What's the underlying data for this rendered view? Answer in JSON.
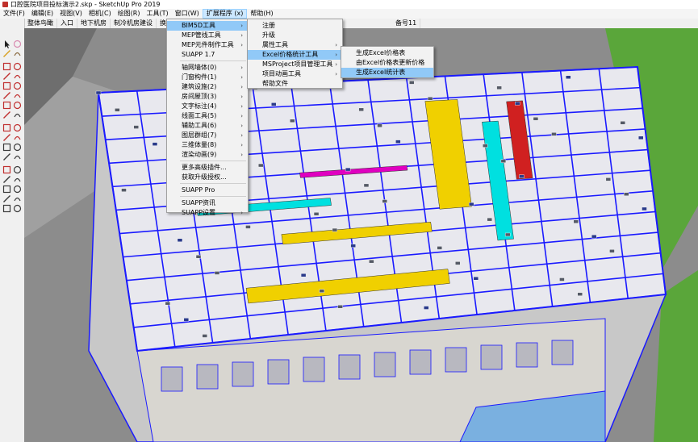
{
  "window": {
    "title": "口腔医院项目投标演示2.skp - SketchUp Pro 2019"
  },
  "menubar": [
    {
      "label": "文件(F)"
    },
    {
      "label": "编辑(E)"
    },
    {
      "label": "视图(V)"
    },
    {
      "label": "相机(C)"
    },
    {
      "label": "绘图(R)"
    },
    {
      "label": "工具(T)"
    },
    {
      "label": "窗口(W)"
    },
    {
      "label": "扩展程序 (x)"
    },
    {
      "label": "帮助(H)"
    }
  ],
  "scene_tabs": [
    "整体鸟瞰",
    "入口",
    "地下机房",
    "制冷机房建设",
    "换热站设备",
    "备号11"
  ],
  "extensions_menu": [
    {
      "label": "BIM5D工具",
      "submenu": true
    },
    {
      "label": "MEP管线工具",
      "submenu": true
    },
    {
      "label": "MEP元件制作工具",
      "submenu": true
    },
    {
      "label": "SUAPP 1.7",
      "submenu": false
    },
    {
      "label": "轴网墙体(0)",
      "submenu": true
    },
    {
      "label": "门窗构件(1)",
      "submenu": true
    },
    {
      "label": "建筑设施(2)",
      "submenu": true
    },
    {
      "label": "房间屋顶(3)",
      "submenu": true
    },
    {
      "label": "文字标注(4)",
      "submenu": true
    },
    {
      "label": "线面工具(5)",
      "submenu": true
    },
    {
      "label": "辅助工具(6)",
      "submenu": true
    },
    {
      "label": "图层群组(7)",
      "submenu": true
    },
    {
      "label": "三维体量(8)",
      "submenu": true
    },
    {
      "label": "渲染动画(9)",
      "submenu": true
    },
    {
      "label": "更多高级插件...",
      "submenu": false
    },
    {
      "label": "获取升级授权...",
      "submenu": false
    },
    {
      "label": "SUAPP Pro",
      "submenu": false
    },
    {
      "label": "SUAPP资讯",
      "submenu": false
    },
    {
      "label": "SUAPP设置",
      "submenu": true
    }
  ],
  "bim5d_menu": [
    {
      "label": "注册",
      "submenu": false
    },
    {
      "label": "升级",
      "submenu": false
    },
    {
      "label": "属性工具",
      "submenu": true
    },
    {
      "label": "Excel价格统计工具",
      "submenu": true
    },
    {
      "label": "MSProject项目管理工具",
      "submenu": true
    },
    {
      "label": "项目动画工具",
      "submenu": true
    },
    {
      "label": "帮助文件",
      "submenu": false
    }
  ],
  "excel_menu": [
    {
      "label": "生成Excel价格表"
    },
    {
      "label": "由Excel价格表更新价格"
    },
    {
      "label": "生成Excel统计表"
    }
  ],
  "toolbar_tools": [
    "select-tool-icon",
    "eraser-tool-icon",
    "paint-bucket-icon",
    "component-icon",
    "line-tool-icon",
    "freehand-tool-icon",
    "rectangle-tool-icon",
    "rotated-rect-icon",
    "circle-tool-icon",
    "polygon-tool-icon",
    "arc-tool-icon",
    "pie-tool-icon",
    "push-pull-icon",
    "follow-me-icon",
    "offset-tool-icon",
    "text-tool-icon",
    "move-tool-icon",
    "rotate-tool-icon",
    "scale-tool-icon",
    "flip-tool-icon",
    "tape-measure-icon",
    "protractor-icon",
    "dimension-tool-icon",
    "axes-tool-icon",
    "orbit-tool-icon",
    "pan-tool-icon",
    "zoom-tool-icon",
    "zoom-window-icon",
    "zoom-extents-icon",
    "previous-view-icon",
    "walk-tool-icon",
    "look-around-icon",
    "position-camera-icon",
    "section-plane-icon"
  ],
  "colors": {
    "menu_highlight": "#91c9f7",
    "model_edges": "#1a1aff",
    "duct_yellow": "#f0d000",
    "pipe_cyan": "#00e0e0",
    "pipe_magenta": "#e000c0"
  }
}
